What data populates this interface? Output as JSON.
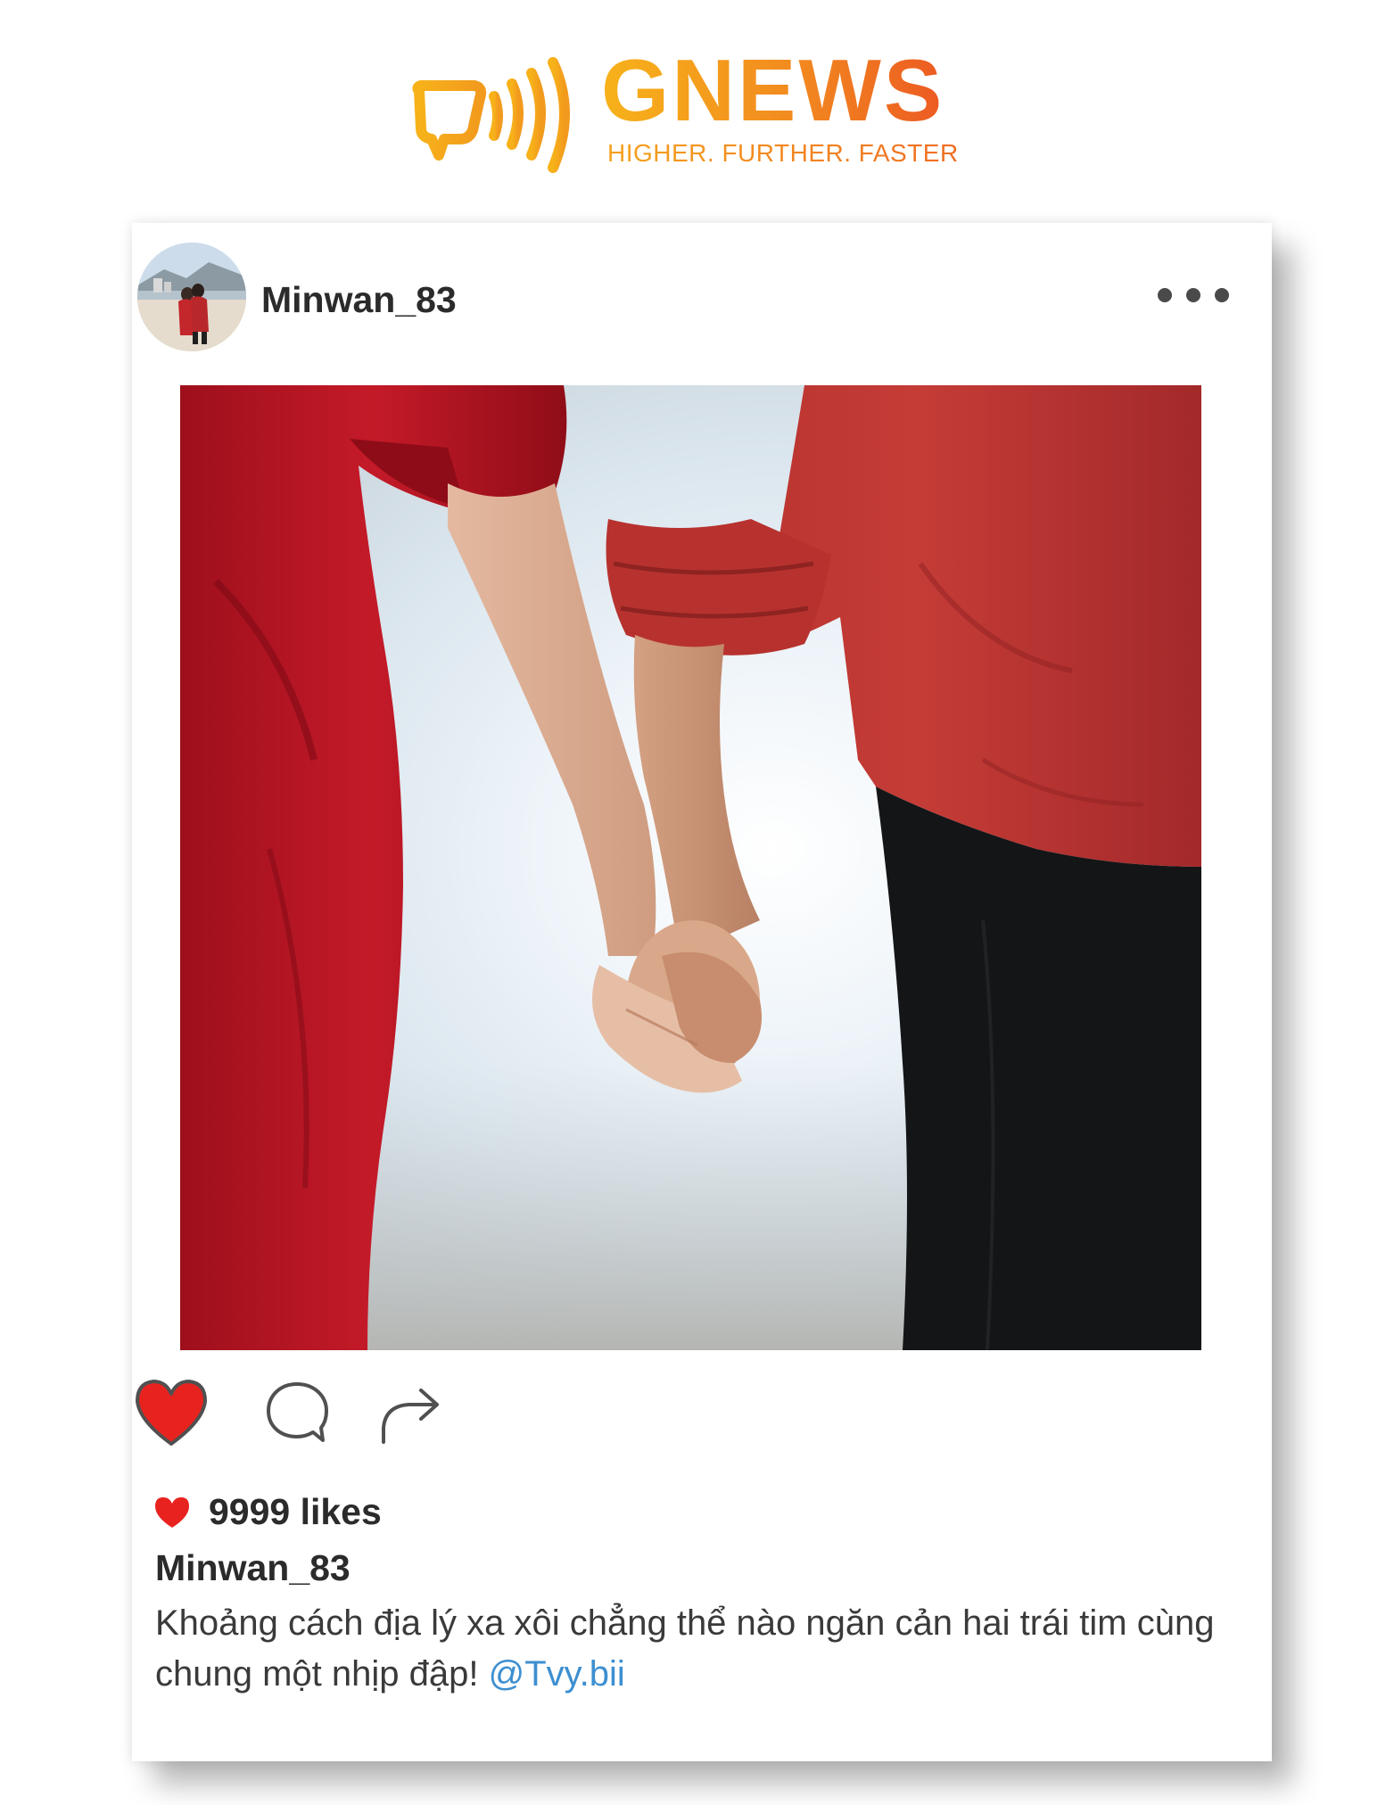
{
  "brand": {
    "name": "GNEWS",
    "slogan": "HIGHER. FURTHER. FASTER",
    "colors": {
      "primary_yellow": "#f7b21a",
      "primary_orange": "#ec5a22"
    },
    "icon": "sound-wave-speech-bubble-icon"
  },
  "post": {
    "username": "Minwan_83",
    "avatar_icon": "profile-avatar",
    "more_icon": "more-options-dots-icon",
    "image_icon": "holding-hands-photo",
    "actions": {
      "like_icon": "heart-icon",
      "comment_icon": "comment-bubble-icon",
      "share_icon": "share-arrow-icon",
      "liked": true
    },
    "likes": "9999 likes",
    "caption_user": "Minwan_83",
    "caption_text": "Khoảng cách địa lý xa xôi chẳng thể nào ngăn cản hai trái tim cùng chung một nhịp đập!",
    "mention": "@Tvy.bii",
    "colors": {
      "heart": "#e8231f",
      "mention": "#3d8fd0"
    }
  }
}
